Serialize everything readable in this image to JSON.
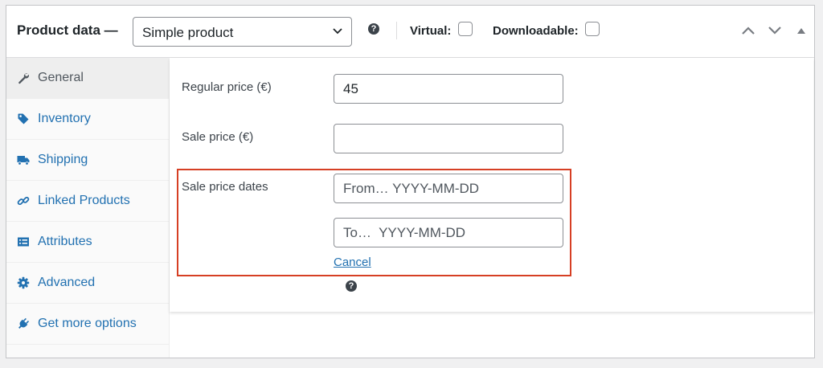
{
  "header": {
    "title": "Product data —",
    "product_type": "Simple product",
    "virtual_label": "Virtual:",
    "downloadable_label": "Downloadable:",
    "help_glyph": "?"
  },
  "sidebar": {
    "items": [
      {
        "label": "General",
        "icon": "wrench-icon"
      },
      {
        "label": "Inventory",
        "icon": "tag-icon"
      },
      {
        "label": "Shipping",
        "icon": "truck-icon"
      },
      {
        "label": "Linked Products",
        "icon": "link-icon"
      },
      {
        "label": "Attributes",
        "icon": "list-icon"
      },
      {
        "label": "Advanced",
        "icon": "gear-icon"
      },
      {
        "label": "Get more options",
        "icon": "plug-icon"
      }
    ]
  },
  "fields": {
    "regular_price_label": "Regular price (€)",
    "regular_price_value": "45",
    "sale_price_label": "Sale price (€)",
    "sale_price_value": "",
    "sale_dates_label": "Sale price dates",
    "from_placeholder": "From… YYYY-MM-DD",
    "to_placeholder": "To…  YYYY-MM-DD",
    "cancel_label": "Cancel",
    "help_glyph": "?"
  },
  "colors": {
    "link": "#2271b1",
    "highlight": "#d63f24",
    "active_tab_bg": "#eeeeee"
  }
}
